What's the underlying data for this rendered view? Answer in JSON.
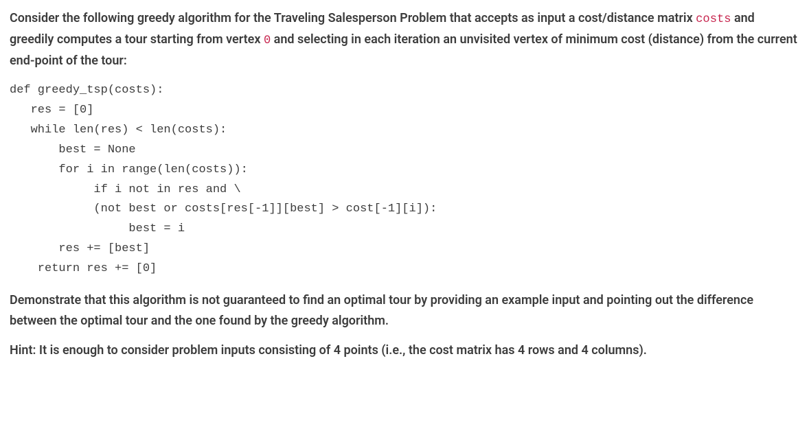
{
  "intro": {
    "part1": "Consider the following greedy algorithm for the Traveling Salesperson Problem that accepts as input a cost/distance matrix ",
    "code1": "costs",
    "part2": " and greedily computes a tour starting from vertex ",
    "code2": "0",
    "part3": " and selecting in each iteration an unvisited vertex of minimum cost (distance) from the current end-point of the tour:"
  },
  "code": "def greedy_tsp(costs):\n   res = [0]\n   while len(res) < len(costs):\n       best = None\n       for i in range(len(costs)):\n            if i not in res and \\\n            (not best or costs[res[-1]][best] > cost[-1][i]):\n                 best = i\n       res += [best]\n    return res += [0]",
  "task": "Demonstrate that this algorithm is not guaranteed to find an optimal tour by providing an example input and pointing out the difference between the optimal tour and the one found by the greedy algorithm.",
  "hint": "Hint: It is enough to consider problem inputs consisting of 4 points (i.e., the cost matrix has 4 rows and 4 columns)."
}
